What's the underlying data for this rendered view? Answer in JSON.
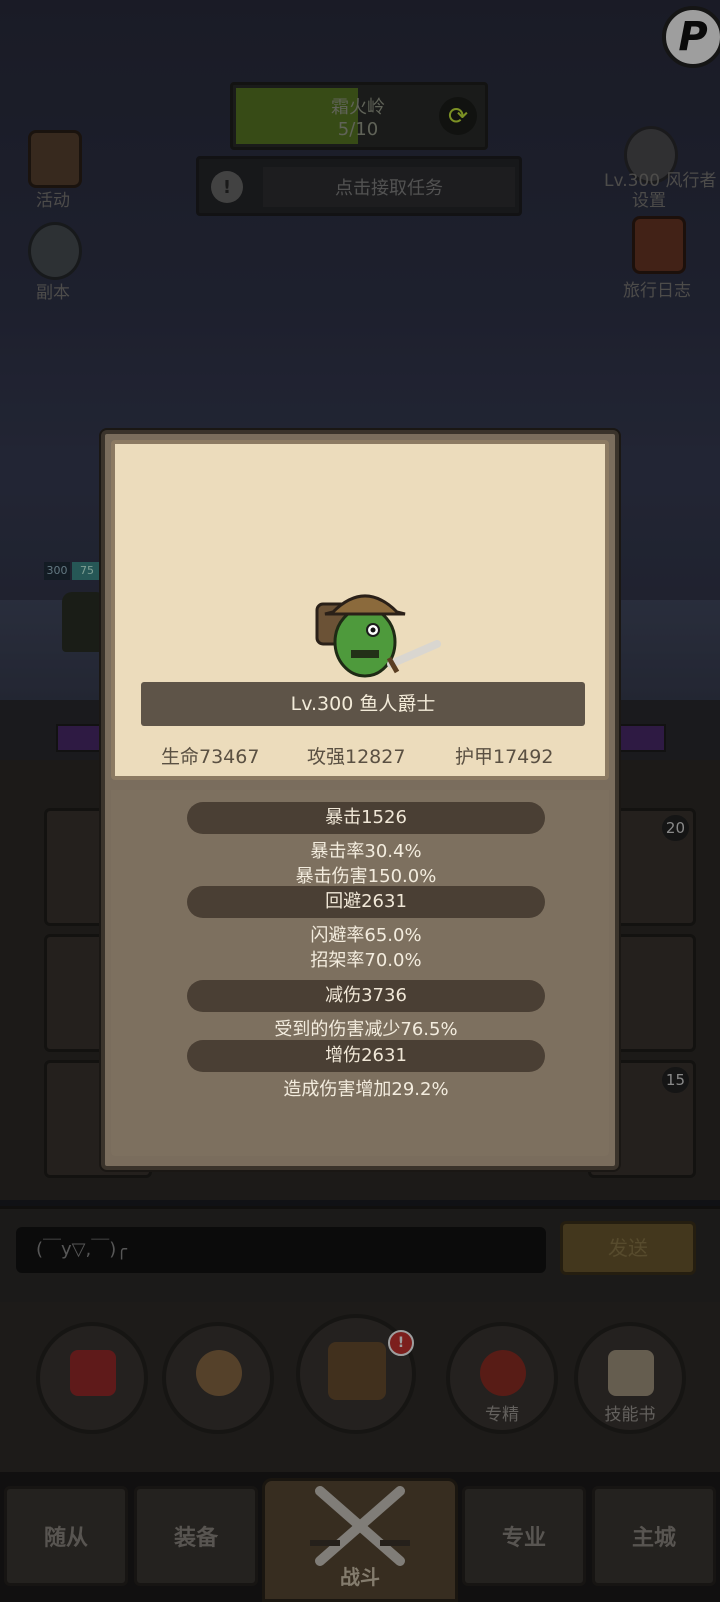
{
  "corner": {
    "glyph": "P"
  },
  "area": {
    "name": "霜火岭",
    "progress": "5/10",
    "refresh_icon": "⟳"
  },
  "quest": {
    "button_label": "点击接取任务",
    "icon_glyph": "!"
  },
  "left_icons": [
    {
      "label": "活动",
      "icon": "book-icon"
    },
    {
      "label": "副本",
      "icon": "portal-icon"
    }
  ],
  "right_icons": [
    {
      "label": "设置",
      "icon": "gear-icon"
    },
    {
      "label": "旅行日志",
      "icon": "journal-icon"
    }
  ],
  "level_tag": "Lv.300 风行者",
  "hero": {
    "level": "300",
    "hp_label": "75"
  },
  "slots": {
    "badge_top_right": "20",
    "badge_bottom_right": "15"
  },
  "chat": {
    "input_value": "(￣y▽,￣)╭",
    "send_label": "发送"
  },
  "actions": [
    {
      "label": "",
      "icon": "potion-icon"
    },
    {
      "label": "",
      "icon": "bread-icon"
    },
    {
      "label": "",
      "icon": "chest-icon",
      "alert": "!"
    },
    {
      "label": "专精",
      "icon": "specialize-icon"
    },
    {
      "label": "技能书",
      "icon": "skillbook-icon"
    }
  ],
  "nav": {
    "tabs": [
      "随从",
      "装备",
      "专业",
      "主城"
    ],
    "battle_label": "战斗"
  },
  "popup": {
    "name": "Lv.300 鱼人爵士",
    "stats": {
      "hp": "生命73467",
      "atk": "攻强12827",
      "armor": "护甲17492"
    },
    "sections": [
      {
        "title": "暴击1526",
        "lines": [
          "暴击率30.4%",
          "暴击伤害150.0%"
        ]
      },
      {
        "title": "回避2631",
        "lines": [
          "闪避率65.0%",
          "招架率70.0%"
        ]
      },
      {
        "title": "减伤3736",
        "lines": [
          "受到的伤害减少76.5%"
        ]
      },
      {
        "title": "增伤2631",
        "lines": [
          "造成伤害增加29.2%"
        ]
      }
    ]
  },
  "colors": {
    "accent_green": "#5a7a24",
    "popup_paper": "#ecdcbc",
    "popup_body": "#7d705f",
    "banner": "#5e5448"
  }
}
